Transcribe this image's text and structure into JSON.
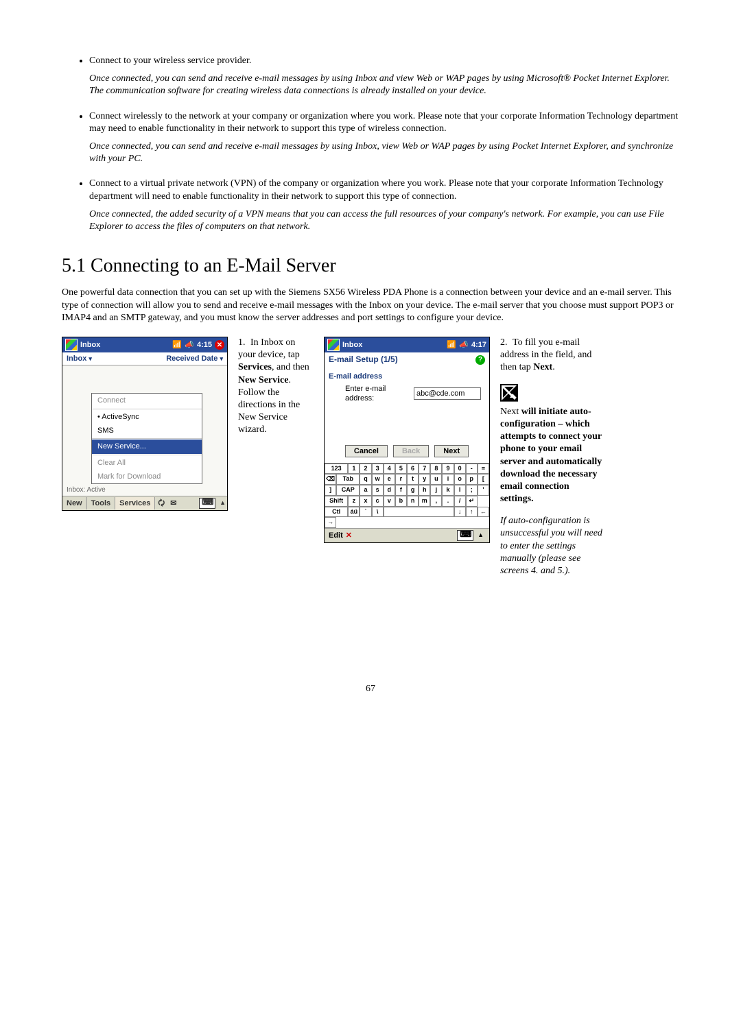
{
  "bullets": [
    {
      "main": "Connect to your wireless service provider.",
      "note": "Once connected, you can send and receive e-mail messages by using Inbox and view Web or WAP pages by using Microsoft® Pocket Internet Explorer. The communication software for creating wireless data connections is already installed on your device."
    },
    {
      "main": "Connect wirelessly to the network at your company or organization where you work.  Please note that your corporate Information Technology department may need to enable functionality in their network to support this type of wireless connection.",
      "note": "Once connected, you can send and receive e-mail messages by using Inbox, view Web or WAP pages by using Pocket Internet Explorer, and synchronize with your PC."
    },
    {
      "main": "Connect to a virtual private network (VPN) of the company or organization where you work.  Please note that your corporate Information Technology department will need to enable functionality in their network to support this type of connection.",
      "note": "Once connected, the added security of a VPN means that you can access the full resources of your company's network. For example, you can use File Explorer to access the files of computers on that network."
    }
  ],
  "heading": "5.1 Connecting to an E-Mail Server",
  "intro": "One powerful data connection that you can set up with the Siemens SX56 Wireless PDA Phone is a connection between your device and an e-mail server.  This type of connection will allow you to send and receive e-mail messages with the Inbox on your device.  The e-mail server that you choose must support POP3 or IMAP4 and an SMTP gateway, and you must know the server addresses and port settings to configure your device.",
  "pda1": {
    "title": "Inbox",
    "time": "4:15",
    "sub_left": "Inbox",
    "sub_right": "Received Date",
    "menu": {
      "connect": "Connect",
      "activesync": "• ActiveSync",
      "sms": "  SMS",
      "newservice": "New Service...",
      "clearall": "Clear All",
      "markdl": "Mark for Download"
    },
    "status": "Inbox: Active",
    "bottom": {
      "new": "New",
      "tools": "Tools",
      "services": "Services"
    }
  },
  "step1": {
    "num": "1.",
    "body": "In Inbox on your device, tap ",
    "services_bold": "Services",
    "comma": ", and then ",
    "new_bold": "New Service",
    "period": ". Follow the directions in the New Service wizard."
  },
  "pda2": {
    "title": "Inbox",
    "time": "4:17",
    "setup": "E-mail Setup (1/5)",
    "addr_label": "E-mail address",
    "enter_email": "Enter e-mail address:",
    "value": "abc@cde.com",
    "cancel": "Cancel",
    "back": "Back",
    "next": "Next",
    "edit": "Edit",
    "kbd_rows": [
      [
        "123",
        "1",
        "2",
        "3",
        "4",
        "5",
        "6",
        "7",
        "8",
        "9",
        "0",
        "-",
        "=",
        "⌫"
      ],
      [
        "Tab",
        "q",
        "w",
        "e",
        "r",
        "t",
        "y",
        "u",
        "i",
        "o",
        "p",
        "[",
        "]"
      ],
      [
        "CAP",
        "a",
        "s",
        "d",
        "f",
        "g",
        "h",
        "j",
        "k",
        "l",
        ";",
        "'"
      ],
      [
        "Shift",
        "z",
        "x",
        "c",
        "v",
        "b",
        "n",
        "m",
        ",",
        ".",
        "/",
        "↵"
      ],
      [
        "Ctl",
        "áü",
        "`",
        "\\",
        " ",
        " ",
        " ",
        " ",
        " ",
        "↓",
        "↑",
        "←",
        "→"
      ]
    ]
  },
  "step2": {
    "num": "2.",
    "line1": "To fill you e-mail address in the field, and then tap ",
    "next_bold": "Next",
    "period1": ".",
    "note_lead": "Next ",
    "note_bold": "will initiate auto-configuration – which attempts to connect your phone to your email server and automatically download the necessary email connection settings.",
    "note_italic": "If auto-configuration is unsuccessful you will need to enter the settings manually (please see screens 4. and 5.)."
  },
  "page_number": "67"
}
